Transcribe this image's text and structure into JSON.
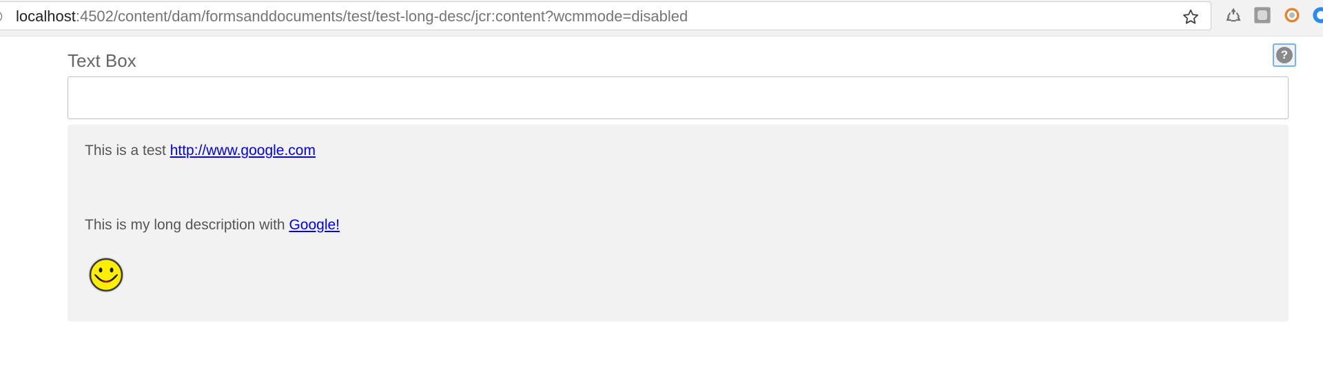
{
  "browser": {
    "url_host": "localhost",
    "url_rest": ":4502/content/dam/formsanddocuments/test/test-long-desc/jcr:content?wcmmode=disabled",
    "info_icon": "info-icon",
    "star_icon": "star-icon",
    "extensions": [
      "recycle-icon",
      "square-extension-icon",
      "orange-circle-extension-icon",
      "blue-circle-extension-icon"
    ]
  },
  "form": {
    "help_icon": "?",
    "field_label": "Text Box",
    "text_value": "",
    "text_placeholder": "",
    "description": {
      "line1_text": "This is a test ",
      "line1_link": "http://www.google.com",
      "line2_text": "This is my long description with ",
      "line2_link": "Google!",
      "image": "smiley-face-image"
    }
  },
  "colors": {
    "link": "#0000ee",
    "panel_bg": "#f2f2f2",
    "help_focus": "#7aaef5"
  }
}
